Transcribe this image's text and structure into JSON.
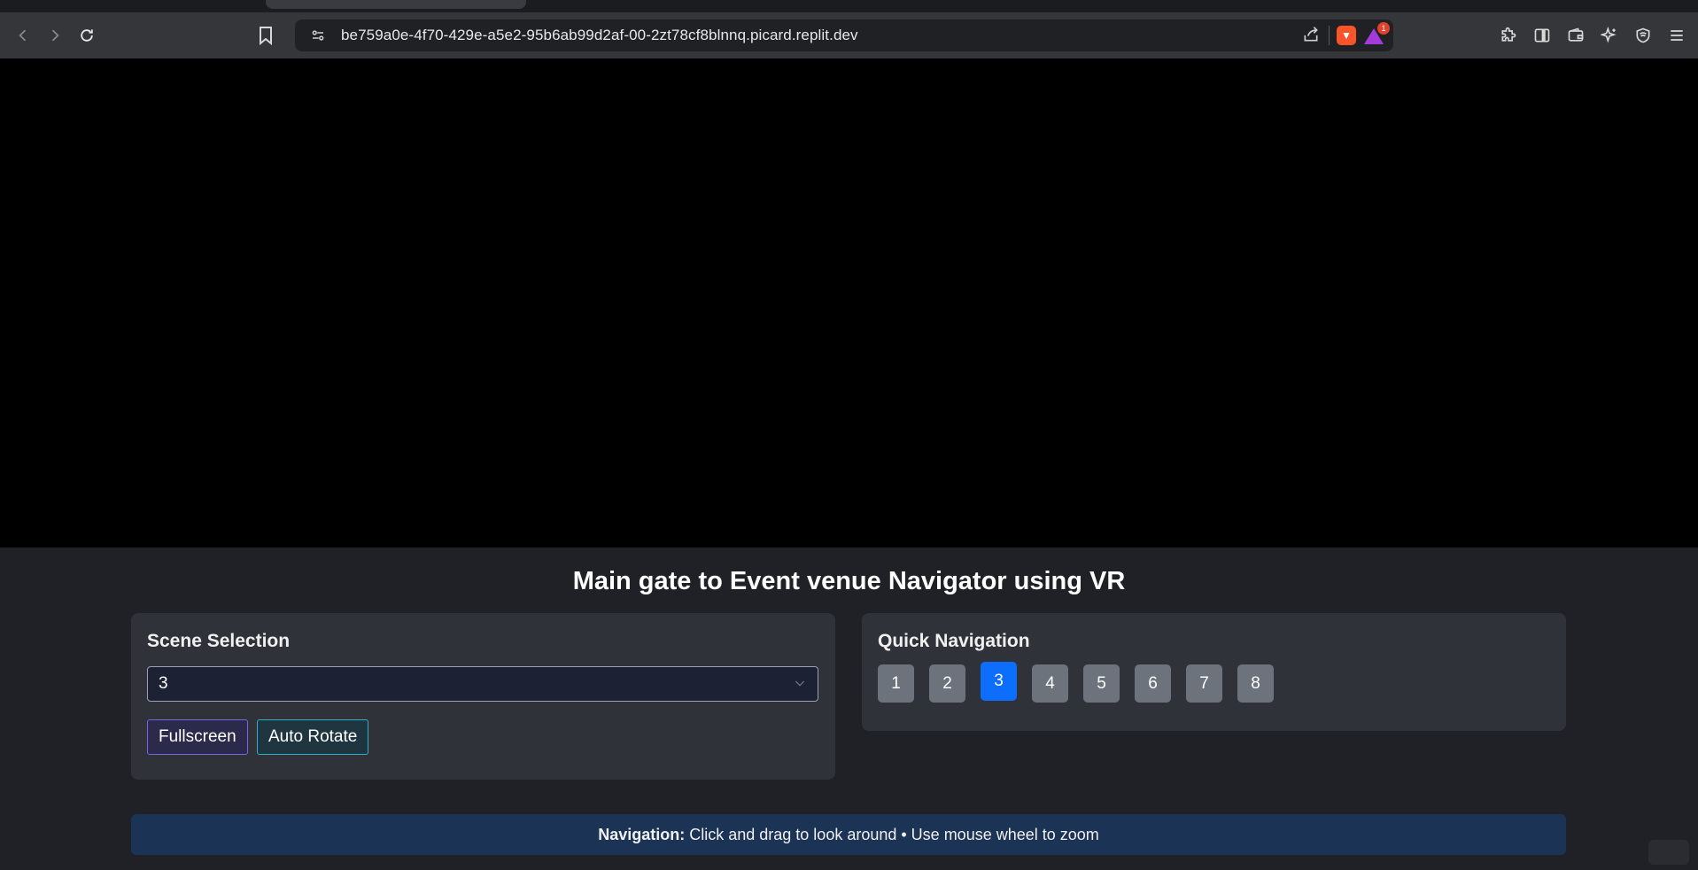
{
  "browser": {
    "url": "be759a0e-4f70-429e-a5e2-95b6ab99d2af-00-2zt78cf8blnnq.picard.replit.dev",
    "rewards_badge": "1"
  },
  "page": {
    "title": "Main gate to Event venue Navigator using VR",
    "scene_selection": {
      "heading": "Scene Selection",
      "selected": "3",
      "fullscreen_label": "Fullscreen",
      "auto_rotate_label": "Auto Rotate"
    },
    "quick_navigation": {
      "heading": "Quick Navigation",
      "buttons": [
        "1",
        "2",
        "3",
        "4",
        "5",
        "6",
        "7",
        "8"
      ],
      "active": "3"
    },
    "info": {
      "bold": "Navigation:",
      "text": "Click and drag to look around • Use mouse wheel to zoom"
    }
  },
  "colors": {
    "accent_active": "#0d6efd",
    "nav_button": "#6c737d",
    "info_bg": "#1b3355"
  }
}
